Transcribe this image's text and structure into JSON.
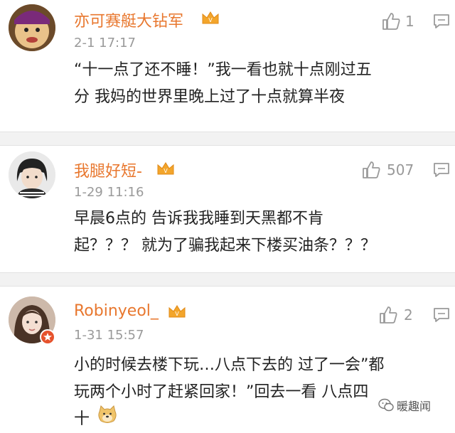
{
  "comments": [
    {
      "username": "亦可赛艇大钻军",
      "time": "2-1 17:17",
      "likes": "1",
      "lines": [
        "“十一点了还不睡！”我一看也就十点刚过五",
        "分 我妈的世界里晚上过了十点就算半夜"
      ]
    },
    {
      "username": "我腿好短-",
      "time": "1-29 11:16",
      "likes": "507",
      "lines": [
        "早晨6点的 告诉我我睡到天黑都不肯",
        "起？？？ 就为了骗我起来下楼买油条？？？"
      ]
    },
    {
      "username": "Robinyeol_",
      "time": "1-31 15:57",
      "likes": "2",
      "lines": [
        "小的时候去楼下玩…八点下去的 过了一会”都",
        "玩两个小时了赶紧回家！”回去一看 八点四",
        "十"
      ]
    }
  ],
  "watermark": {
    "text": "暖趣闻"
  },
  "icons": {
    "like": "thumbs-up-icon",
    "reply": "comment-icon",
    "vip": "crown-icon",
    "emoji": "doge-emoji-icon",
    "badge": "verified-badge-icon"
  },
  "colors": {
    "username": "#e8772e",
    "separator": "#f2f2f2"
  }
}
